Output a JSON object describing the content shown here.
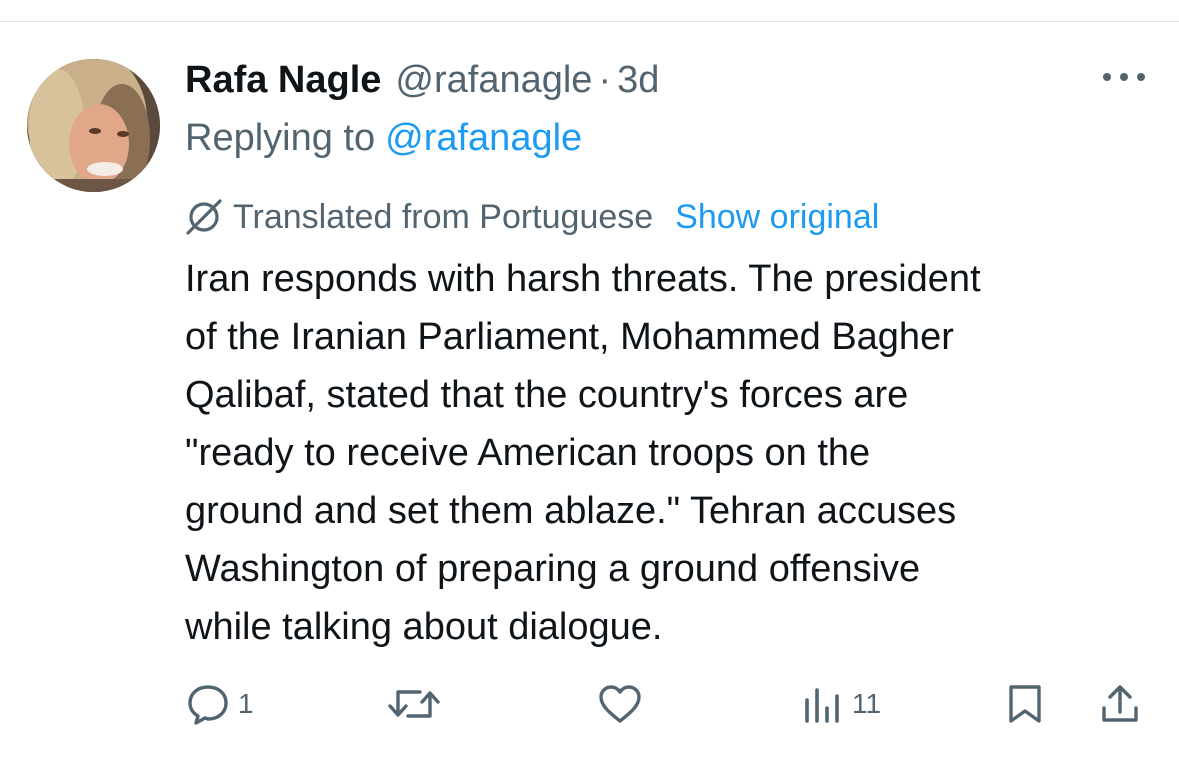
{
  "tweet": {
    "display_name": "Rafa Nagle",
    "handle": "@rafanagle",
    "separator": "·",
    "time": "3d",
    "replying_prefix": "Replying to",
    "replying_to": "@rafanagle",
    "translated_label": "Translated from Portuguese",
    "show_original_label": "Show original",
    "text_lines": [
      "Iran responds with harsh threats. The president",
      "of the Iranian Parliament, Mohammed Bagher",
      "Qalibaf, stated that the country's forces are",
      "\"ready to receive American troops on the",
      "ground and set them ablaze.\" Tehran accuses",
      "Washington of preparing a ground offensive",
      "while talking about dialogue."
    ]
  },
  "actions": {
    "reply_count": "1",
    "views_count": "11"
  },
  "icons": {
    "more": "more-horizontal-icon",
    "translate": "globe-icon",
    "reply": "speech-bubble-icon",
    "repost": "repost-icon",
    "like": "heart-icon",
    "views": "bar-chart-icon",
    "bookmark": "bookmark-icon",
    "share": "share-icon"
  },
  "colors": {
    "text": "#0f1419",
    "secondary": "#536471",
    "link": "#1d9bf0",
    "divider": "#dfe3e6"
  }
}
